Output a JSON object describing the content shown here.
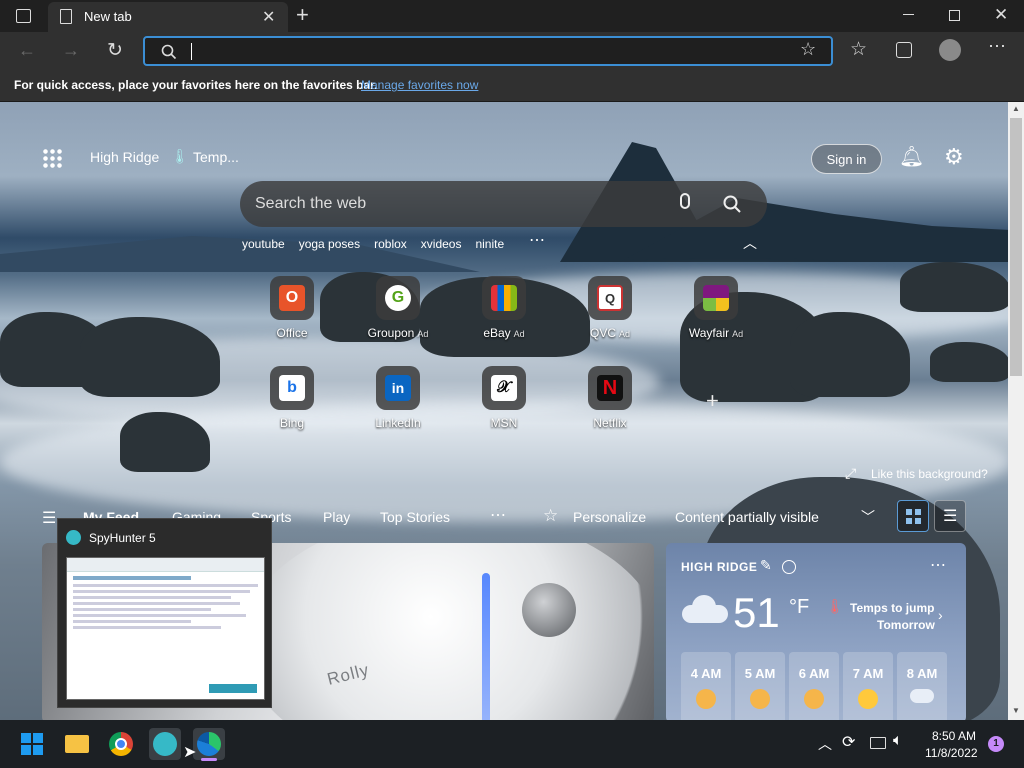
{
  "browser": {
    "tab_title": "New tab",
    "address_value": "",
    "favorites_prompt": "For quick access, place your favorites here on the favorites bar.",
    "favorites_link": "Manage favorites now"
  },
  "ntp": {
    "location": "High Ridge",
    "temp_label": "Temp...",
    "sign_in": "Sign in",
    "search_placeholder": "Search the web",
    "suggestions": [
      "youtube",
      "yoga poses",
      "roblox",
      "xvideos",
      "ninite"
    ],
    "tiles_row1": [
      {
        "label": "Office",
        "ad": ""
      },
      {
        "label": "Groupon",
        "ad": "Ad"
      },
      {
        "label": "eBay",
        "ad": "Ad"
      },
      {
        "label": "QVC",
        "ad": "Ad"
      },
      {
        "label": "Wayfair",
        "ad": "Ad"
      }
    ],
    "tiles_row2": [
      {
        "label": "Bing"
      },
      {
        "label": "LinkedIn"
      },
      {
        "label": "MSN"
      },
      {
        "label": "Netflix"
      }
    ],
    "like_background": "Like this background?",
    "feed_tabs": [
      "My Feed",
      "Gaming",
      "Sports",
      "Play",
      "Top Stories"
    ],
    "personalize": "Personalize",
    "content_visibility": "Content partially visible"
  },
  "article": {
    "product_text": "Rolly"
  },
  "weather": {
    "location": "HIGH RIDGE",
    "temp": "51",
    "unit": "°F",
    "note_line1": "Temps to jump",
    "note_line2": "Tomorrow",
    "hours": [
      "4 AM",
      "5 AM",
      "6 AM",
      "7 AM",
      "8 AM"
    ]
  },
  "popup": {
    "title": "SpyHunter 5"
  },
  "taskbar": {
    "time": "8:50 AM",
    "date": "11/8/2022",
    "notification_count": "1"
  }
}
